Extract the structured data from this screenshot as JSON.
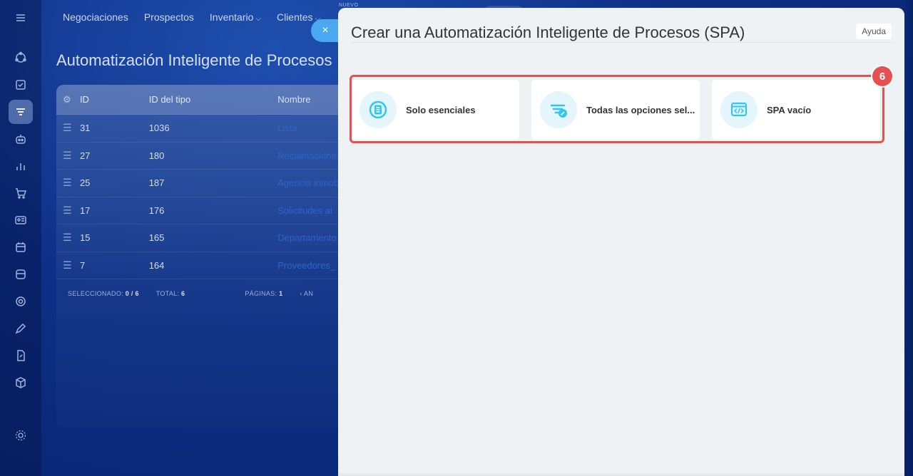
{
  "topnav": {
    "items": [
      "Negociaciones",
      "Prospectos",
      "Inventario",
      "Clientes"
    ],
    "new_badge": "NUEVO"
  },
  "page": {
    "title": "Automatización Inteligente de Procesos"
  },
  "table": {
    "headers": [
      "ID",
      "ID del tipo",
      "Nombre"
    ],
    "rows": [
      {
        "id": "31",
        "type_id": "1036",
        "name": "Lista"
      },
      {
        "id": "27",
        "type_id": "180",
        "name": "Reclamaciones"
      },
      {
        "id": "25",
        "type_id": "187",
        "name": "Agencia inmob"
      },
      {
        "id": "17",
        "type_id": "176",
        "name": "Solicitudes al"
      },
      {
        "id": "15",
        "type_id": "165",
        "name": "Departamento"
      },
      {
        "id": "7",
        "type_id": "164",
        "name": "Proveedores_"
      }
    ],
    "footer": {
      "selected_label": "SELECCIONADO:",
      "selected_value": "0 / 6",
      "total_label": "TOTAL:",
      "total_value": "6",
      "pages_label": "PÁGINAS:",
      "pages_value": "1",
      "prev_label": "AN"
    }
  },
  "slider": {
    "title": "Crear una Automatización Inteligente de Procesos (SPA)",
    "help_label": "Ayuda",
    "close_icon": "×",
    "step_number": "6",
    "options": [
      {
        "label": "Solo esenciales",
        "icon": "document-list-icon"
      },
      {
        "label": "Todas las opciones sel...",
        "icon": "filter-edit-icon"
      },
      {
        "label": "SPA vacío",
        "icon": "code-window-icon"
      }
    ]
  },
  "colors": {
    "accent": "#2fc6f6",
    "highlight": "#e55050",
    "link": "#2b64c9"
  }
}
